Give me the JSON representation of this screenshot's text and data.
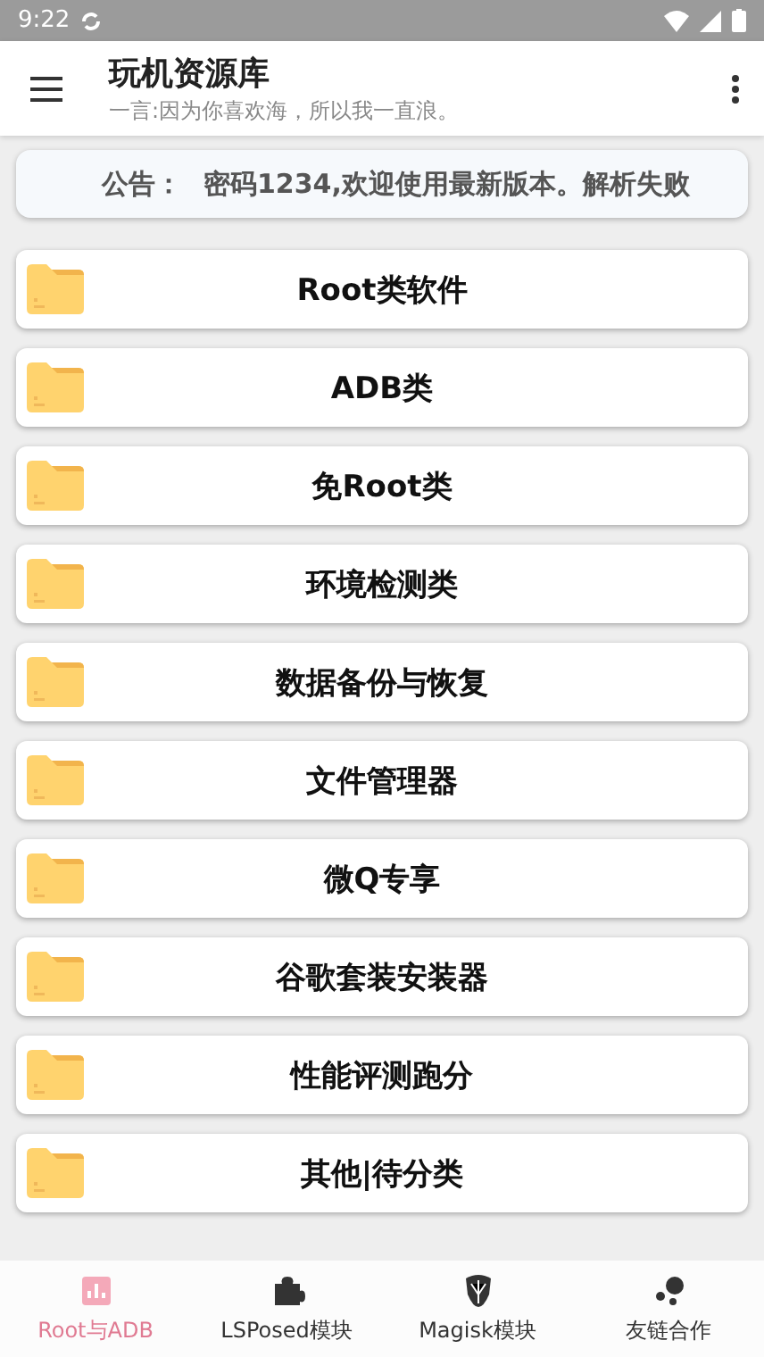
{
  "status_bar": {
    "time": "9:22"
  },
  "app_bar": {
    "title": "玩机资源库",
    "subtitle": "一言:因为你喜欢海，所以我一直浪。"
  },
  "notice": {
    "label": "公告：",
    "text": "密码1234,欢迎使用最新版本。解析失败"
  },
  "categories": [
    {
      "label": "Root类软件"
    },
    {
      "label": "ADB类"
    },
    {
      "label": "免Root类"
    },
    {
      "label": "环境检测类"
    },
    {
      "label": "数据备份与恢复"
    },
    {
      "label": "文件管理器"
    },
    {
      "label": "微Q专享"
    },
    {
      "label": "谷歌套装安装器"
    },
    {
      "label": "性能评测跑分"
    },
    {
      "label": "其他|待分类"
    }
  ],
  "bottom_nav": [
    {
      "label": "Root与ADB",
      "selected": true
    },
    {
      "label": "LSPosed模块",
      "selected": false
    },
    {
      "label": "Magisk模块",
      "selected": false
    },
    {
      "label": "友链合作",
      "selected": false
    }
  ]
}
